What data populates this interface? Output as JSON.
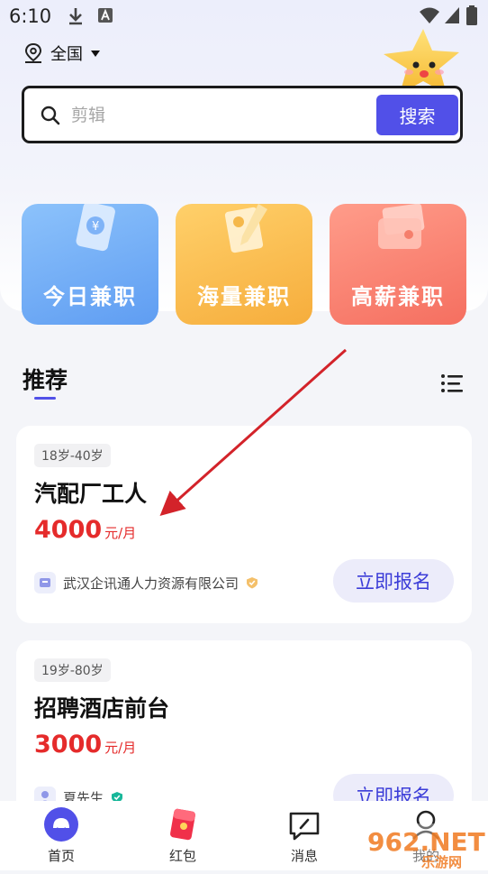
{
  "status_bar": {
    "time": "6:10"
  },
  "location": {
    "label": "全国"
  },
  "search": {
    "placeholder": "剪辑",
    "button_label": "搜索"
  },
  "categories": [
    {
      "label": "今日兼职",
      "color": "#6aa8f5"
    },
    {
      "label": "海量兼职",
      "color": "#f8b84a"
    },
    {
      "label": "高薪兼职",
      "color": "#f57f6c"
    }
  ],
  "section": {
    "title": "推荐"
  },
  "jobs": [
    {
      "age": "18岁-40岁",
      "title": "汽配厂工人",
      "salary": "4000",
      "unit": "元/月",
      "company": "武汉企讯通人力资源有限公司",
      "apply_label": "立即报名"
    },
    {
      "age": "19岁-80岁",
      "title": "招聘酒店前台",
      "salary": "3000",
      "unit": "元/月",
      "company": "夏先生",
      "apply_label": "立即报名"
    }
  ],
  "nav": [
    {
      "label": "首页",
      "icon": "home-icon"
    },
    {
      "label": "红包",
      "icon": "red-envelope-icon"
    },
    {
      "label": "消息",
      "icon": "message-icon"
    },
    {
      "label": "我的",
      "icon": "profile-icon"
    }
  ],
  "watermark": {
    "text": "962.NET",
    "subtext": "乐游网"
  },
  "colors": {
    "accent": "#5150e8",
    "salary": "#e52b2b",
    "annotation_arrow": "#d3232a"
  }
}
